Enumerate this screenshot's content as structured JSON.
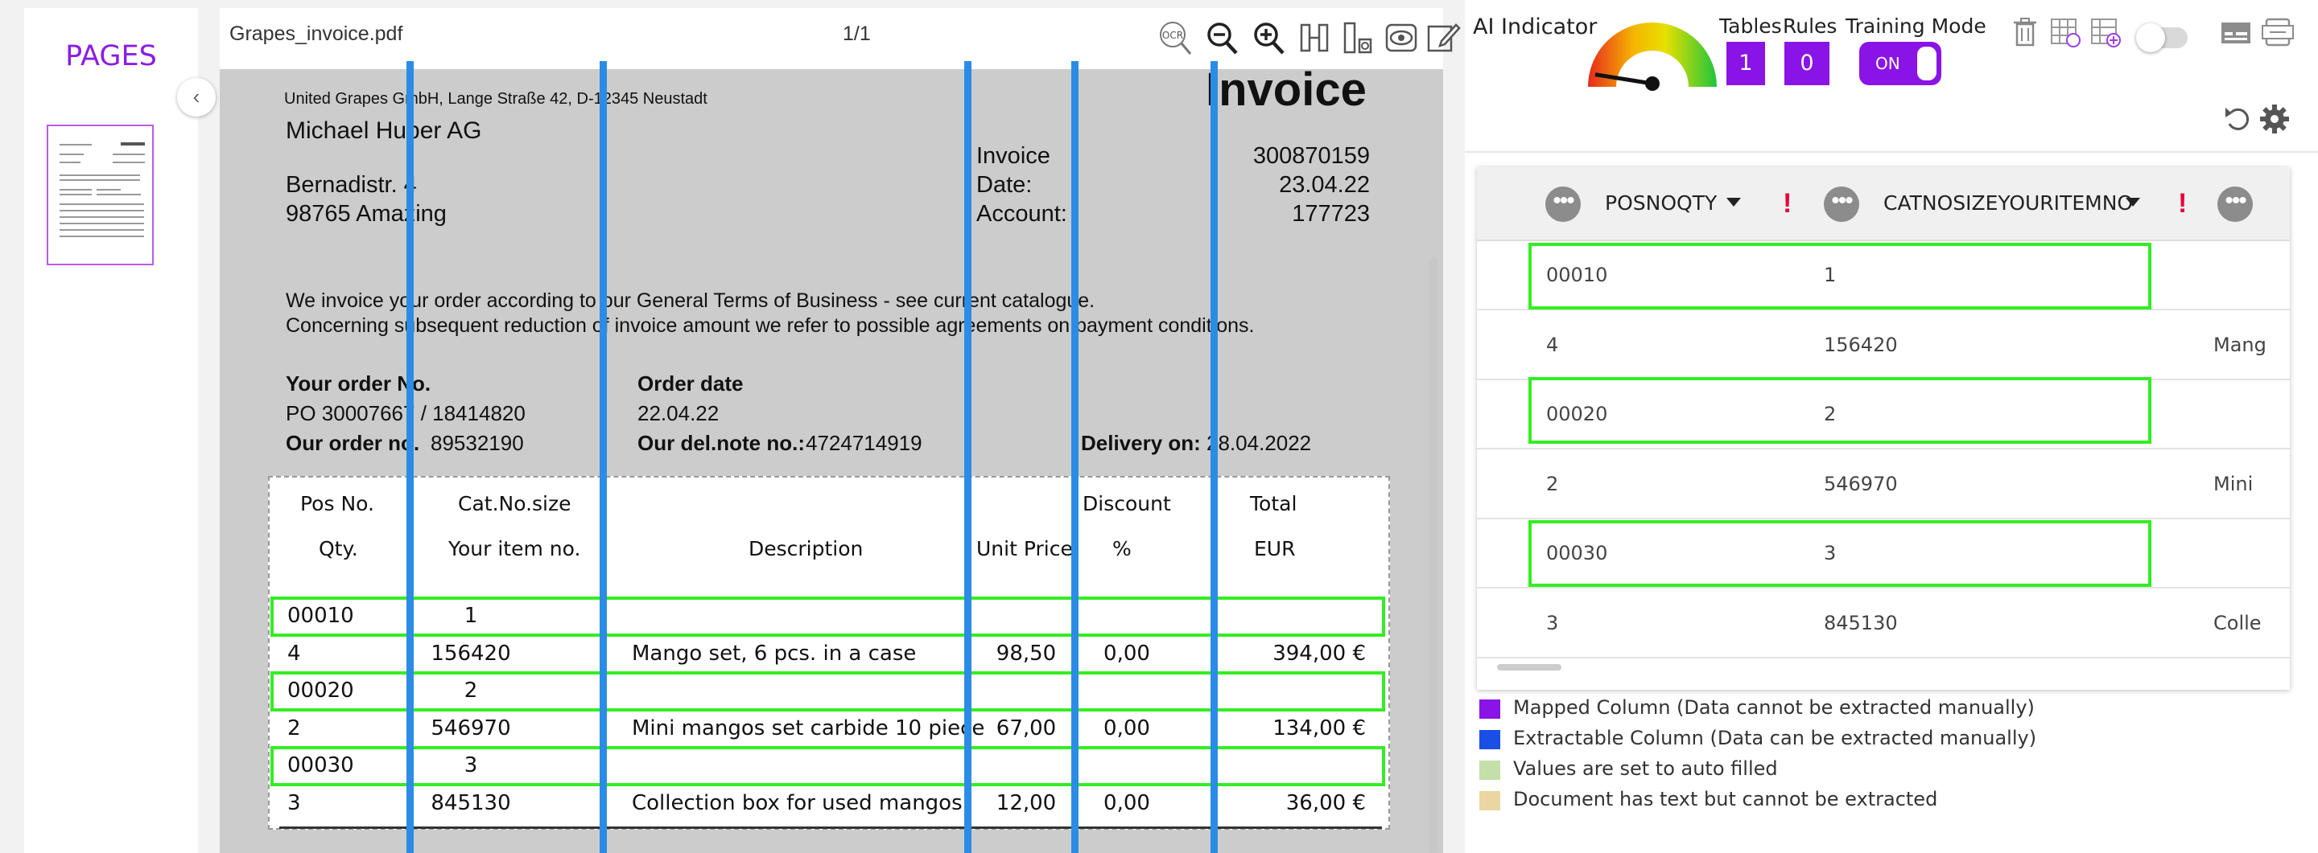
{
  "sidebar": {
    "title": "PAGES",
    "collapse_icon": "chevron-left-icon"
  },
  "viewer": {
    "file_name": "Grapes_invoice.pdf",
    "page_indicator": "1/1",
    "tools": [
      "ocr-icon",
      "zoom-out-icon",
      "zoom-in-icon",
      "column-split-icon",
      "row-split-icon",
      "eye-icon",
      "edit-icon"
    ],
    "ocr_label": "OCR"
  },
  "invoice": {
    "sender": "United Grapes GmbH, Lange Straße 42, D-12345 Neustadt",
    "title": "Invoice",
    "customer_name": "Michael Huber AG",
    "street": "Bernadistr. 4",
    "city": "98765 Amazing",
    "meta_labels": [
      "Invoice",
      "Date:",
      "Account:"
    ],
    "meta_values": [
      "300870159",
      "23.04.22",
      "177723"
    ],
    "terms_line1": "We invoice your order according to our General Terms of Business - see current catalogue.",
    "terms_line2": "Concerning subsequent reduction of invoice amount we refer to possible agreements on payment conditions.",
    "your_order_label": "Your order No.",
    "your_order_value": "PO 30007667 / 18414820",
    "our_order_label": "Our order no.",
    "our_order_value": "89532190",
    "order_date_label": "Order date",
    "order_date_value": "22.04.22",
    "del_note_label": "Our del.note no.:",
    "del_note_value": "4724714919",
    "delivery_label": "Delivery on:",
    "delivery_value": "28.04.2022",
    "headers": {
      "pos": "Pos No.",
      "qty": "Qty.",
      "cat": "Cat.No.size",
      "item": "Your item no.",
      "desc": "Description",
      "unit": "Unit Price",
      "disc": "Discount",
      "pct": "%",
      "total": "Total",
      "eur": "EUR"
    },
    "rows": [
      {
        "c1": "00010",
        "c2": "1",
        "c3": "",
        "c4": "",
        "c5": "",
        "c6": ""
      },
      {
        "c1": "4",
        "c2": "156420",
        "c3": "Mango set, 6 pcs. in a case",
        "c4": "98,50",
        "c5": "0,00",
        "c6": "394,00 €"
      },
      {
        "c1": "00020",
        "c2": "2",
        "c3": "",
        "c4": "",
        "c5": "",
        "c6": ""
      },
      {
        "c1": "2",
        "c2": "546970",
        "c3": "Mini mangos set carbide 10 piece",
        "c4": "67,00",
        "c5": "0,00",
        "c6": "134,00 €"
      },
      {
        "c1": "00030",
        "c2": "3",
        "c3": "",
        "c4": "",
        "c5": "",
        "c6": ""
      },
      {
        "c1": "3",
        "c2": "845130",
        "c3": "Collection box for used mangos",
        "c4": "12,00",
        "c5": "0,00",
        "c6": "36,00 €"
      }
    ]
  },
  "panel": {
    "ai_label": "AI Indicator",
    "ai_gauge_level": 0.05,
    "tables_label": "Tables",
    "tables_count": "1",
    "rules_label": "Rules",
    "rules_count": "0",
    "training_label": "Training Mode",
    "training_state": "ON",
    "icons": [
      "trash-icon",
      "table-edit-icon",
      "table-add-icon",
      "toggle-switch",
      "layout-icon",
      "ocr-table-icon",
      "undo-icon",
      "gear-icon"
    ],
    "accent": "#8a14e6"
  },
  "grid": {
    "columns": [
      "POSNOQTY",
      "CATNOSIZEYOURITEMNO"
    ],
    "rows": [
      {
        "a": "00010",
        "b": "1",
        "c": ""
      },
      {
        "a": "4",
        "b": "156420",
        "c": "Mang"
      },
      {
        "a": "00020",
        "b": "2",
        "c": ""
      },
      {
        "a": "2",
        "b": "546970",
        "c": "Mini"
      },
      {
        "a": "00030",
        "b": "3",
        "c": ""
      },
      {
        "a": "3",
        "b": "845130",
        "c": "Colle"
      }
    ]
  },
  "legend": [
    {
      "color": "#8a14e6",
      "text": "Mapped Column (Data cannot be extracted manually)"
    },
    {
      "color": "#1a4fe6",
      "text": "Extractable Column (Data can be extracted manually)"
    },
    {
      "color": "#c2e0a8",
      "text": "Values are set to auto filled"
    },
    {
      "color": "#e9d6a0",
      "text": "Document has text but cannot be extracted"
    }
  ]
}
